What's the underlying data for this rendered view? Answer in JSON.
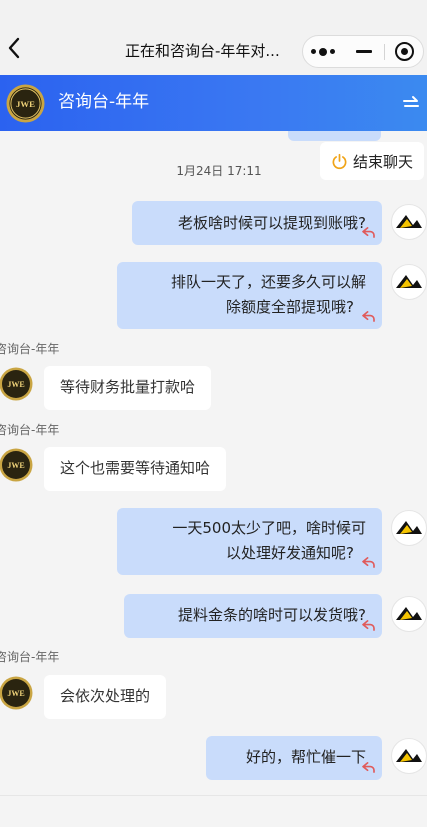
{
  "nav": {
    "title": "正在和咨询台-年年对...",
    "back_icon": "chevron-left-icon",
    "more_icon": "more-dots-icon",
    "minimize_icon": "minimize-icon",
    "close_icon": "target-close-icon"
  },
  "header": {
    "title": "咨询台-年年",
    "avatar_text": "JWE",
    "switch_icon": "switch-arrow-icon",
    "accent": "#2b62f0"
  },
  "end_chat": {
    "label": "结束聊天",
    "icon": "power-icon"
  },
  "timestamp": "1月24日 17:11",
  "messages": [
    {
      "dir": "out",
      "lines": [
        "老板啥时候可以提现到账哦?"
      ]
    },
    {
      "dir": "out",
      "lines": [
        "排队一天了，还要多久可以解",
        "除额度全部提现哦?"
      ]
    },
    {
      "dir": "in",
      "sender": "咨询台-年年",
      "lines": [
        "等待财务批量打款哈"
      ]
    },
    {
      "dir": "in",
      "sender": "咨询台-年年",
      "lines": [
        "这个也需要等待通知哈"
      ]
    },
    {
      "dir": "out",
      "lines": [
        "一天500太少了吧，啥时候可",
        "以处理好发通知呢?"
      ]
    },
    {
      "dir": "out",
      "lines": [
        "提料金条的啥时可以发货哦?"
      ]
    },
    {
      "dir": "in",
      "sender": "咨询台-年年",
      "lines": [
        "会依次处理的"
      ]
    },
    {
      "dir": "out",
      "lines": [
        "好的，帮忙催一下"
      ]
    }
  ],
  "colors": {
    "out_bubble": "#c9dcfb",
    "in_bubble": "#ffffff",
    "background": "#f4f4f4"
  }
}
